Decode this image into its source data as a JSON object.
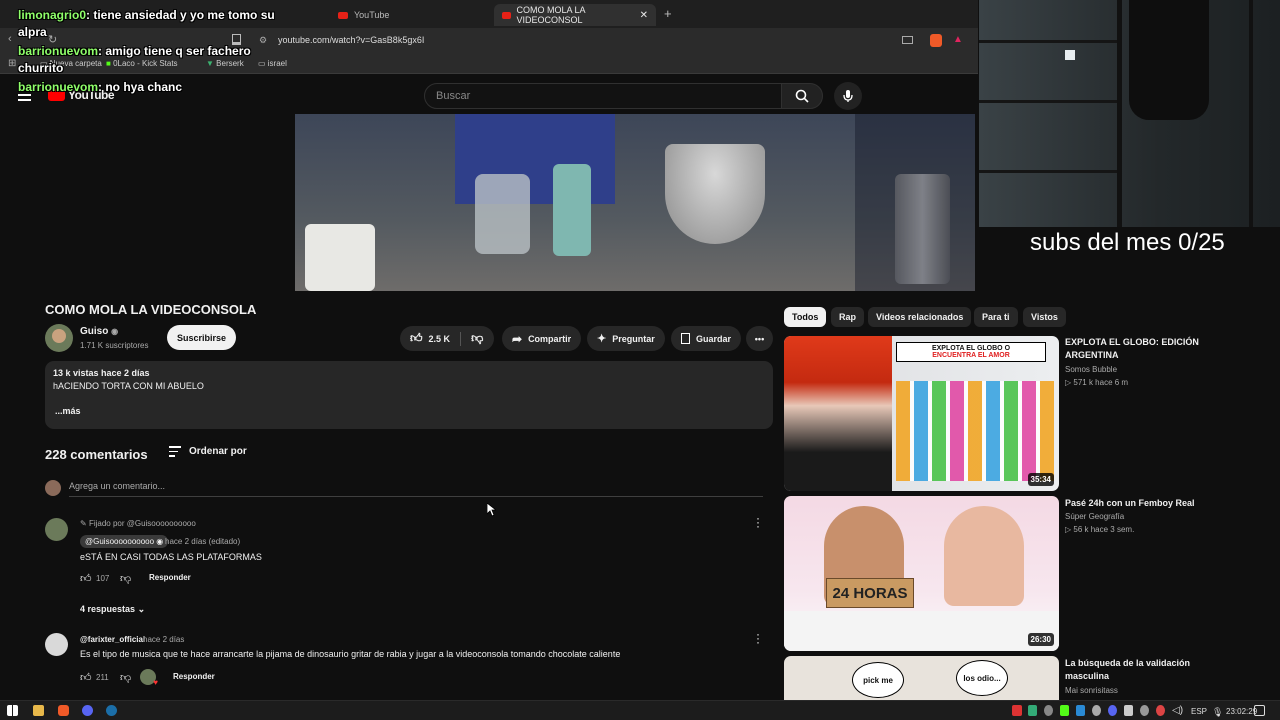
{
  "browser": {
    "tabs": [
      {
        "label": "YouTube"
      },
      {
        "label": "COMO MOLA LA VIDEOCONSOL"
      }
    ],
    "url": "youtube.com/watch?v=GasB8k5gx6I",
    "bookmarks": [
      "Nueva carpeta",
      "0Laco - Kick Stats",
      "Berserk",
      "israel"
    ]
  },
  "youtube": {
    "logo": "YouTube",
    "search_placeholder": "Buscar"
  },
  "chat": [
    {
      "user": "limonagrio0",
      "text": ": tiene ansiedad y yo me tomo su"
    },
    {
      "user": "",
      "text": "alpra"
    },
    {
      "user": "barrionuevom",
      "text": ": amigo tiene q ser fachero"
    },
    {
      "user": "",
      "text": "churrito"
    },
    {
      "user": "barrionuevom",
      "text": ": no hya chanc"
    }
  ],
  "overlay": {
    "subs": "subs del mes 0/25"
  },
  "video": {
    "title": "COMO MOLA LA VIDEOCONSOLA",
    "channel": "Guiso",
    "subscribers": "1.71 K suscriptores",
    "subscribe_label": "Suscribirse",
    "likes": "2.5 K",
    "share_label": "Compartir",
    "ask_label": "Preguntar",
    "save_label": "Guardar",
    "views_date": "13 k vistas  hace 2 días",
    "description": "hACIENDO TORTA CON MI ABUELO",
    "more_label": "...más"
  },
  "comments": {
    "count": "228 comentarios",
    "sort_label": "Ordenar por",
    "input_placeholder": "Agrega un comentario...",
    "items": [
      {
        "pinned": "Fijado por @Guisoooooooooo",
        "author": "@Guisoooooooooo",
        "time": "hace 2 días (editado)",
        "text": "eSTÁ EN CASI TODAS LAS PLATAFORMAS",
        "likes": "107",
        "reply": "Responder",
        "replies": "4 respuestas"
      },
      {
        "author": "@farixter_official",
        "time": "hace 2 días",
        "text": "Es el tipo de musica que te hace arrancarte la pijama de dinosaurio gritar de rabia y jugar a la videoconsola tomando chocolate caliente",
        "likes": "211",
        "reply": "Responder"
      }
    ]
  },
  "chips": [
    "Todos",
    "Rap",
    "Videos relacionados",
    "Para ti",
    "Vistos"
  ],
  "related": [
    {
      "title_line1": "EXPLOTA EL GLOBO: EDICIÓN",
      "title_line2": "ARGENTINA",
      "channel": "Somos Bubble",
      "meta": "▷ 571 k  hace 6 m",
      "duration": "35:34",
      "thumb_text1": "EXPLOTA EL GLOBO O",
      "thumb_text2": "ENCUENTRA EL AMOR"
    },
    {
      "title_line1": "Pasé 24h con un Femboy Real",
      "title_line2": "",
      "channel": "Súper Geografía",
      "meta": "▷ 56 k  hace 3 sem.",
      "duration": "26:30",
      "thumb_text1": "24 HORAS",
      "thumb_text2": ""
    },
    {
      "title_line1": "La búsqueda de la validación",
      "title_line2": "masculina",
      "channel": "Mai sonrisitass",
      "meta": "",
      "duration": "",
      "thumb_text1": "pick me",
      "thumb_text2": "los odio..."
    }
  ],
  "taskbar": {
    "lang": "ESP",
    "time": "23:02:29"
  }
}
